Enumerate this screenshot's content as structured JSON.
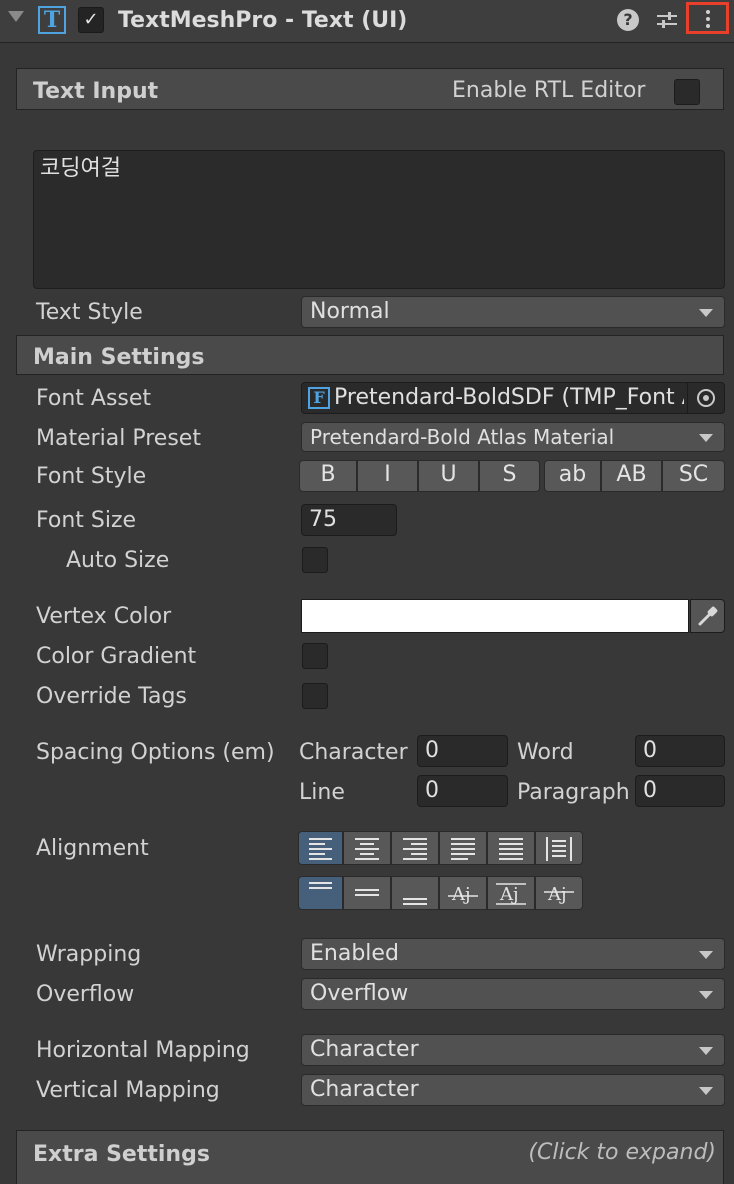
{
  "header": {
    "title": "TextMeshPro - Text (UI)",
    "component_icon": "T",
    "enabled_check": "✓",
    "help_glyph": "?"
  },
  "text_input": {
    "section_title": "Text Input",
    "rtl_label": "Enable RTL Editor",
    "rtl_enabled": false,
    "text_value": "코딩여걸",
    "text_style_label": "Text Style",
    "text_style_value": "Normal"
  },
  "main_settings": {
    "section_title": "Main Settings",
    "font_asset_label": "Font Asset",
    "font_asset_icon": "F",
    "font_asset_value": "Pretendard-BoldSDF (TMP_Font Asset)",
    "material_preset_label": "Material Preset",
    "material_preset_value": "Pretendard-Bold Atlas Material",
    "font_style_label": "Font Style",
    "font_style_buttons": [
      "B",
      "I",
      "U",
      "S",
      "ab",
      "AB",
      "SC"
    ],
    "font_size_label": "Font Size",
    "font_size_value": "75",
    "auto_size_label": "Auto Size",
    "auto_size_enabled": false,
    "vertex_color_label": "Vertex Color",
    "vertex_color_value": "#ffffff",
    "color_gradient_label": "Color Gradient",
    "color_gradient_enabled": false,
    "override_tags_label": "Override Tags",
    "override_tags_enabled": false,
    "spacing_label": "Spacing Options (em)",
    "spacing": {
      "character_label": "Character",
      "character_value": "0",
      "word_label": "Word",
      "word_value": "0",
      "line_label": "Line",
      "line_value": "0",
      "paragraph_label": "Paragraph",
      "paragraph_value": "0"
    },
    "alignment_label": "Alignment",
    "horizontal_alignment_selected": "left",
    "vertical_alignment_selected": "top",
    "wrapping_label": "Wrapping",
    "wrapping_value": "Enabled",
    "overflow_label": "Overflow",
    "overflow_value": "Overflow",
    "horizontal_mapping_label": "Horizontal Mapping",
    "horizontal_mapping_value": "Character",
    "vertical_mapping_label": "Vertical Mapping",
    "vertical_mapping_value": "Character"
  },
  "extra_settings": {
    "section_title": "Extra Settings",
    "hint": "(Click to expand)"
  },
  "colors": {
    "background": "#383838",
    "accent_selected": "#46607c",
    "highlight_border": "#e8402a",
    "icon_blue": "#4fa3e0"
  }
}
